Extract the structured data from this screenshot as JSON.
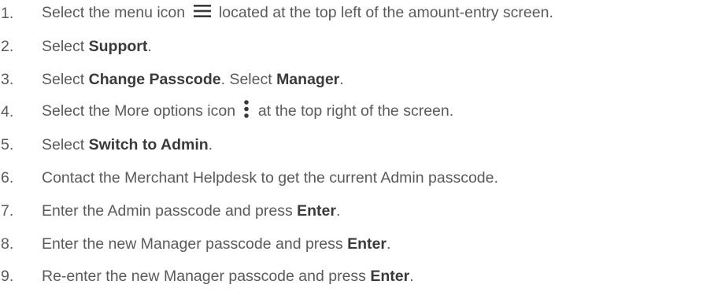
{
  "steps": [
    {
      "number": "1.",
      "before_icon": "Select the menu icon",
      "icon": "menu-icon",
      "after_icon": "located at the top left of the amount-entry screen."
    },
    {
      "number": "2.",
      "prefix": "Select ",
      "bold": "Support",
      "suffix": "."
    },
    {
      "number": "3.",
      "prefix": "Select ",
      "bold": "Change Passcode",
      "middle": ". Select ",
      "bold2": "Manager",
      "suffix": "."
    },
    {
      "number": "4.",
      "before_icon": "Select the More options icon",
      "icon": "more-options-icon",
      "after_icon": "at the top right of the screen."
    },
    {
      "number": "5.",
      "prefix": "Select ",
      "bold": "Switch to Admin",
      "suffix": "."
    },
    {
      "number": "6.",
      "text": "Contact the Merchant Helpdesk to get the current Admin passcode."
    },
    {
      "number": "7.",
      "prefix": "Enter the Admin passcode and press ",
      "bold": "Enter",
      "suffix": "."
    },
    {
      "number": "8.",
      "prefix": "Enter the new Manager passcode and press ",
      "bold": "Enter",
      "suffix": "."
    },
    {
      "number": "9.",
      "prefix": "Re-enter the new Manager passcode and press ",
      "bold": "Enter",
      "suffix": "."
    }
  ]
}
